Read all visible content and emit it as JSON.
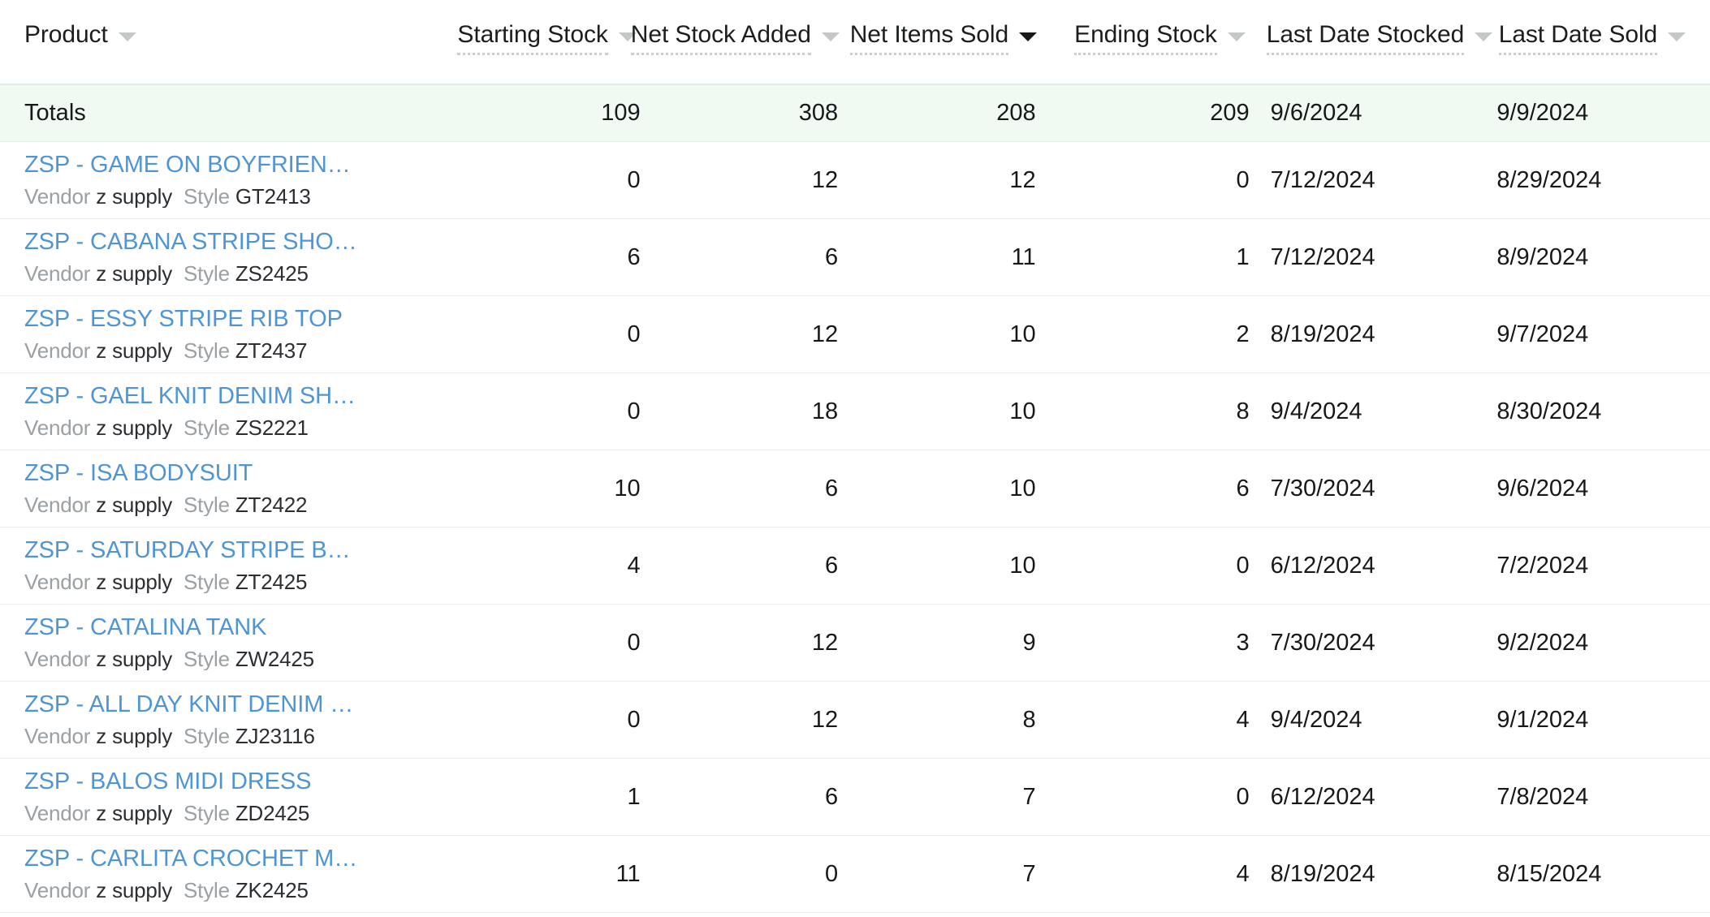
{
  "table": {
    "columns": [
      {
        "key": "product",
        "label": "Product",
        "sort_icon": "chevron-down-icon",
        "sort_active": false,
        "dotted_underline": false
      },
      {
        "key": "starting",
        "label": "Starting Stock",
        "sort_icon": "chevron-down-icon",
        "sort_active": false,
        "dotted_underline": true
      },
      {
        "key": "added",
        "label": "Net Stock Added",
        "sort_icon": "chevron-down-icon",
        "sort_active": false,
        "dotted_underline": true
      },
      {
        "key": "sold",
        "label": "Net Items Sold",
        "sort_icon": "chevron-down-icon",
        "sort_active": true,
        "dotted_underline": true
      },
      {
        "key": "ending",
        "label": "Ending Stock",
        "sort_icon": "chevron-down-icon",
        "sort_active": false,
        "dotted_underline": true
      },
      {
        "key": "last_stocked",
        "label": "Last Date Stocked",
        "sort_icon": "chevron-down-icon",
        "sort_active": false,
        "dotted_underline": true
      },
      {
        "key": "last_sold",
        "label": "Last Date Sold",
        "sort_icon": "chevron-down-icon",
        "sort_active": false,
        "dotted_underline": true
      }
    ],
    "totals": {
      "label": "Totals",
      "starting": "109",
      "added": "308",
      "sold": "208",
      "ending": "209",
      "last_stocked": "9/6/2024",
      "last_sold": "9/9/2024"
    },
    "meta_labels": {
      "vendor": "Vendor",
      "style": "Style"
    },
    "rows": [
      {
        "name": "ZSP - GAME ON BOYFRIEN…",
        "vendor": "z supply",
        "style": "GT2413",
        "starting": "0",
        "added": "12",
        "sold": "12",
        "ending": "0",
        "last_stocked": "7/12/2024",
        "last_sold": "8/29/2024"
      },
      {
        "name": "ZSP - CABANA STRIPE SHO…",
        "vendor": "z supply",
        "style": "ZS2425",
        "starting": "6",
        "added": "6",
        "sold": "11",
        "ending": "1",
        "last_stocked": "7/12/2024",
        "last_sold": "8/9/2024"
      },
      {
        "name": "ZSP - ESSY STRIPE RIB TOP",
        "vendor": "z supply",
        "style": "ZT2437",
        "starting": "0",
        "added": "12",
        "sold": "10",
        "ending": "2",
        "last_stocked": "8/19/2024",
        "last_sold": "9/7/2024"
      },
      {
        "name": "ZSP - GAEL KNIT DENIM SH…",
        "vendor": "z supply",
        "style": "ZS2221",
        "starting": "0",
        "added": "18",
        "sold": "10",
        "ending": "8",
        "last_stocked": "9/4/2024",
        "last_sold": "8/30/2024"
      },
      {
        "name": "ZSP - ISA BODYSUIT",
        "vendor": "z supply",
        "style": "ZT2422",
        "starting": "10",
        "added": "6",
        "sold": "10",
        "ending": "6",
        "last_stocked": "7/30/2024",
        "last_sold": "9/6/2024"
      },
      {
        "name": "ZSP - SATURDAY STRIPE B…",
        "vendor": "z supply",
        "style": "ZT2425",
        "starting": "4",
        "added": "6",
        "sold": "10",
        "ending": "0",
        "last_stocked": "6/12/2024",
        "last_sold": "7/2/2024"
      },
      {
        "name": "ZSP - CATALINA TANK",
        "vendor": "z supply",
        "style": "ZW2425",
        "starting": "0",
        "added": "12",
        "sold": "9",
        "ending": "3",
        "last_stocked": "7/30/2024",
        "last_sold": "9/2/2024"
      },
      {
        "name": "ZSP - ALL DAY KNIT DENIM …",
        "vendor": "z supply",
        "style": "ZJ23116",
        "starting": "0",
        "added": "12",
        "sold": "8",
        "ending": "4",
        "last_stocked": "9/4/2024",
        "last_sold": "9/1/2024"
      },
      {
        "name": "ZSP - BALOS MIDI DRESS",
        "vendor": "z supply",
        "style": "ZD2425",
        "starting": "1",
        "added": "6",
        "sold": "7",
        "ending": "0",
        "last_stocked": "6/12/2024",
        "last_sold": "7/8/2024"
      },
      {
        "name": "ZSP - CARLITA CROCHET M…",
        "vendor": "z supply",
        "style": "ZK2425",
        "starting": "11",
        "added": "0",
        "sold": "7",
        "ending": "4",
        "last_stocked": "8/19/2024",
        "last_sold": "8/15/2024"
      }
    ]
  },
  "colors": {
    "link": "#4f95d6",
    "totals_background": "#f1f9f3",
    "text": "#16181a",
    "muted": "#9aa0a4",
    "border": "#eceeed"
  }
}
